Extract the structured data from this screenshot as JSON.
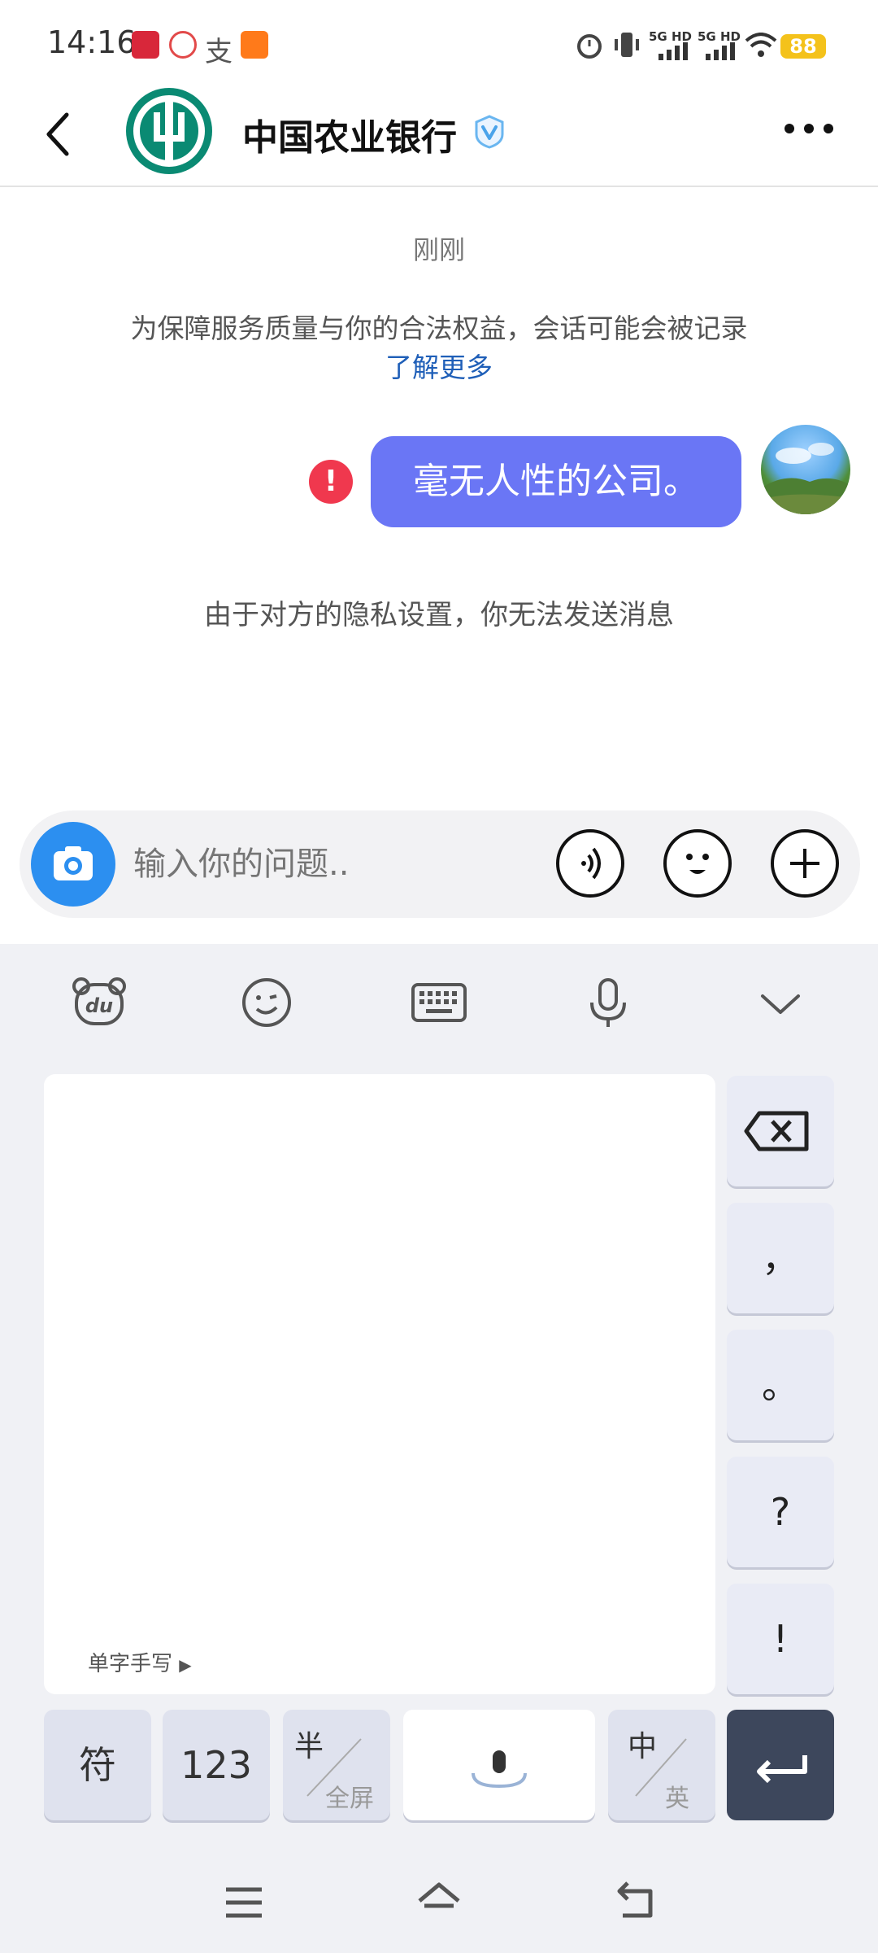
{
  "status_bar": {
    "time": "14:16",
    "network_labels": [
      "5G HD",
      "5G HD"
    ],
    "battery": "88"
  },
  "header": {
    "title": "中国农业银行"
  },
  "chat": {
    "timestamp": "刚刚",
    "notice": "为保障服务质量与你的合法权益，会话可能会被记录",
    "notice_link": "了解更多",
    "messages": [
      {
        "from": "user",
        "text": "毫无人性的公司。",
        "status": "failed"
      }
    ],
    "system_message": "由于对方的隐私设置，你无法发送消息"
  },
  "input": {
    "placeholder": "输入你的问题.."
  },
  "keyboard": {
    "handwriting_label": "单字手写",
    "side_keys": [
      "，",
      "。",
      "?",
      "!"
    ],
    "bottom_keys": {
      "symbols": "符",
      "numbers": "123",
      "half_top": "半",
      "half_bottom": "全屏",
      "lang_top": "中",
      "lang_bottom": "英"
    }
  },
  "colors": {
    "bubble": "#6a76f5",
    "error": "#f0384e",
    "link": "#1f5fb8",
    "bank_logo": "#0a8a73",
    "battery": "#f4c21b",
    "enter_key": "#3d475c"
  }
}
